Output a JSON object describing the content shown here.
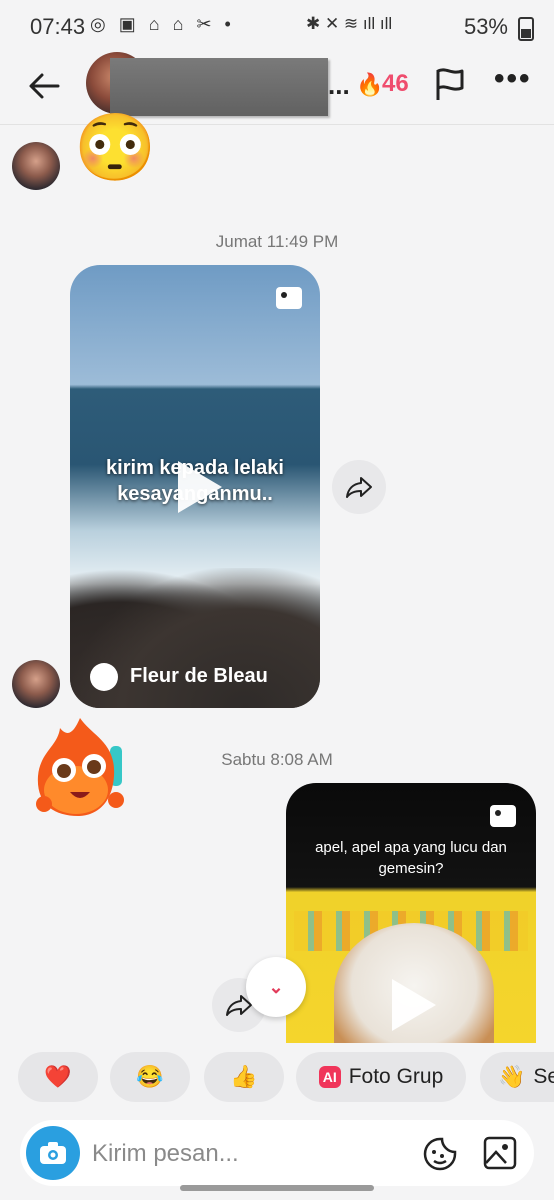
{
  "status_bar": {
    "time": "07:43",
    "battery": "53%",
    "notif_icons": "◎ ▣ ⌂ ⌂ ✂ •"
  },
  "header": {
    "ellipsis": "...",
    "streak_count": "46",
    "fire_emoji": "🔥"
  },
  "messages": {
    "timestamp_1": "Jumat 11:49 PM",
    "video1_caption": "kirim kepada lelaki kesayanganmu..",
    "video1_author": "Fleur de Bleau",
    "timestamp_2": "Sabtu 8:08 AM",
    "video2_caption": "apel, apel apa yang lucu dan gemesin?",
    "emoji_flushed": "😳"
  },
  "quick_replies": [
    {
      "label": "❤️"
    },
    {
      "label": "😂"
    },
    {
      "label": "👍"
    },
    {
      "label": "Foto Grup",
      "badge": "AI"
    },
    {
      "label": "Se",
      "emoji": "👋"
    }
  ],
  "composer": {
    "placeholder": "Kirim pesan..."
  },
  "colors": {
    "accent": "#ef4d6e",
    "camera": "#2a9fe0",
    "background": "#f4f4f5"
  }
}
